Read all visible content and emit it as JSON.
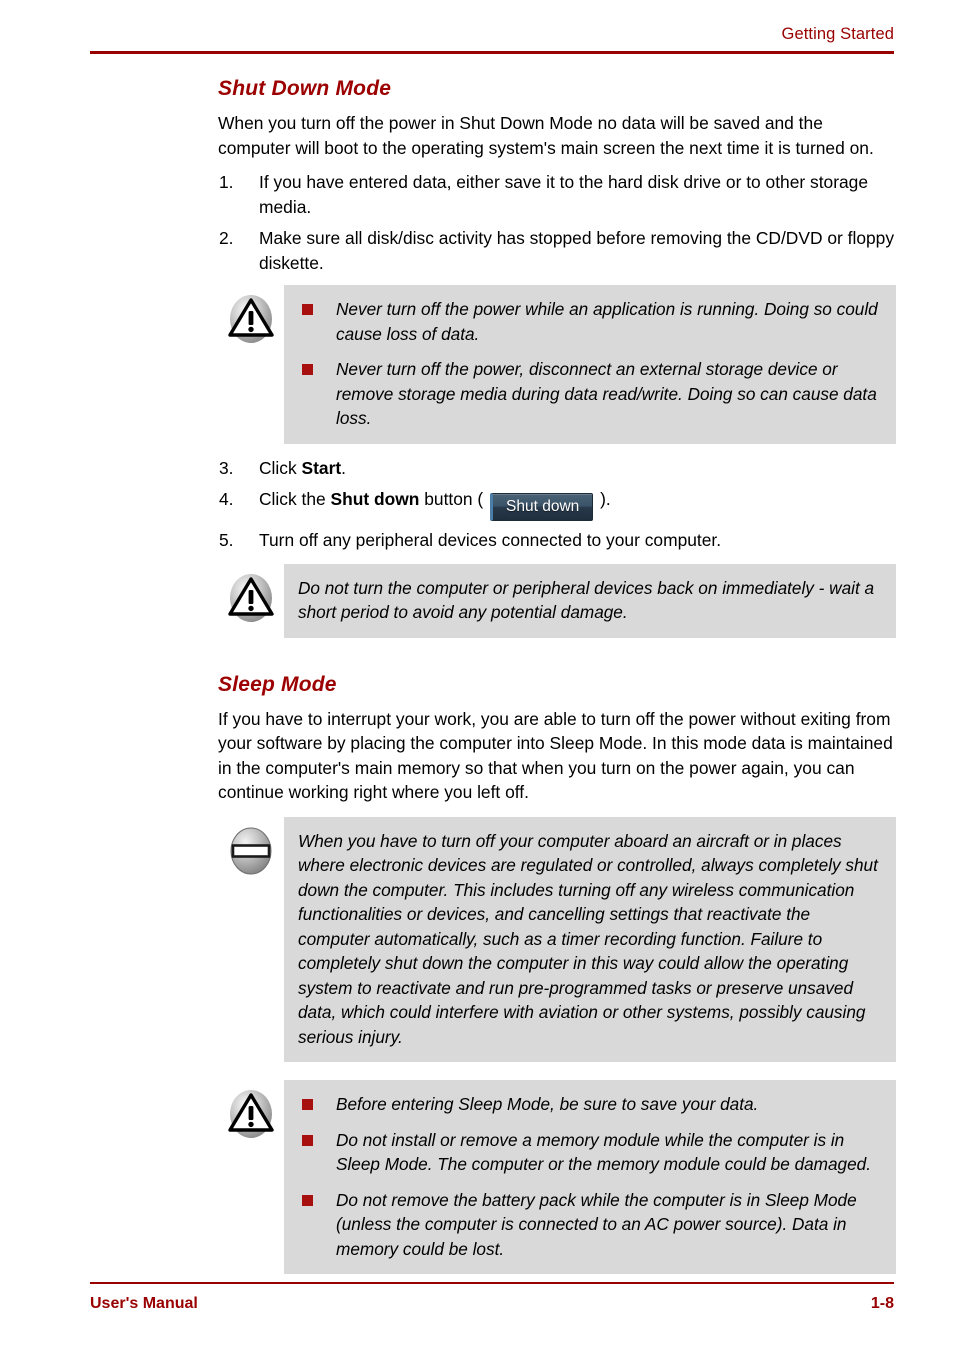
{
  "header": {
    "title": "Getting Started"
  },
  "footer": {
    "manual_label": "User's Manual",
    "page_number": "1-8"
  },
  "colors": {
    "accent_red": "#990000",
    "heading_red": "#9c0000",
    "bullet_red": "#a80f0f",
    "notice_bg": "#d9d9d9",
    "button_blue": "#3c5469"
  },
  "sections": [
    {
      "heading": "Shut Down Mode",
      "intro": "When you turn off the power in Shut Down Mode no data will be saved and the computer will boot to the operating system's main screen the next time it is turned on.",
      "steps": [
        {
          "num": "1.",
          "text": "If you have entered data, either save it to the hard disk drive or to other storage media."
        },
        {
          "num": "2.",
          "text": "Make sure all disk/disc activity has stopped before removing the CD/DVD or floppy diskette."
        }
      ],
      "steps_after": [
        {
          "num": "3.",
          "pre": "Click ",
          "bold": "Start",
          "post": "."
        },
        {
          "num": "4.",
          "pre": "Click the ",
          "bold": "Shut down",
          "mid": " button ( ",
          "button_label": "Shut down",
          "post": " )."
        },
        {
          "num": "5.",
          "text": "Turn off any peripheral devices connected to your computer."
        }
      ]
    },
    {
      "heading": "Sleep Mode",
      "intro": "If you have to interrupt your work, you are able to turn off the power without exiting from your software by placing the computer into Sleep Mode. In this mode data is maintained in the computer's main memory so that when you turn on the power again, you can continue working right where you left off."
    }
  ],
  "notices": {
    "shutdown_caution": {
      "icon": "caution-triangle-icon",
      "bullets": [
        "Never turn off the power while an application is running. Doing so could cause loss of data.",
        "Never turn off the power, disconnect an external storage device or remove storage media during data read/write. Doing so can cause data loss."
      ]
    },
    "restart_caution": {
      "icon": "caution-triangle-icon",
      "text": "Do not turn the computer or peripheral devices back on immediately - wait a short period to avoid any potential damage."
    },
    "aircraft_danger": {
      "icon": "prohibition-circle-icon",
      "text": "When you have to turn off your computer aboard an aircraft or in places where electronic devices are regulated or controlled, always completely shut down the computer. This includes turning off any wireless communication functionalities or devices, and cancelling settings that reactivate the computer automatically, such as a timer recording function. Failure to completely shut down the computer in this way could allow the operating system to reactivate and run pre-programmed tasks or preserve unsaved data, which could interfere with aviation or other systems, possibly causing serious injury."
    },
    "sleep_caution": {
      "icon": "caution-triangle-icon",
      "bullets": [
        "Before entering Sleep Mode, be sure to save your data.",
        "Do not install or remove a memory module while the computer is in Sleep Mode. The computer or the memory module could be damaged.",
        "Do not remove the battery pack while the computer is in Sleep Mode (unless the computer is connected to an AC power source). Data in memory could be lost."
      ]
    }
  }
}
